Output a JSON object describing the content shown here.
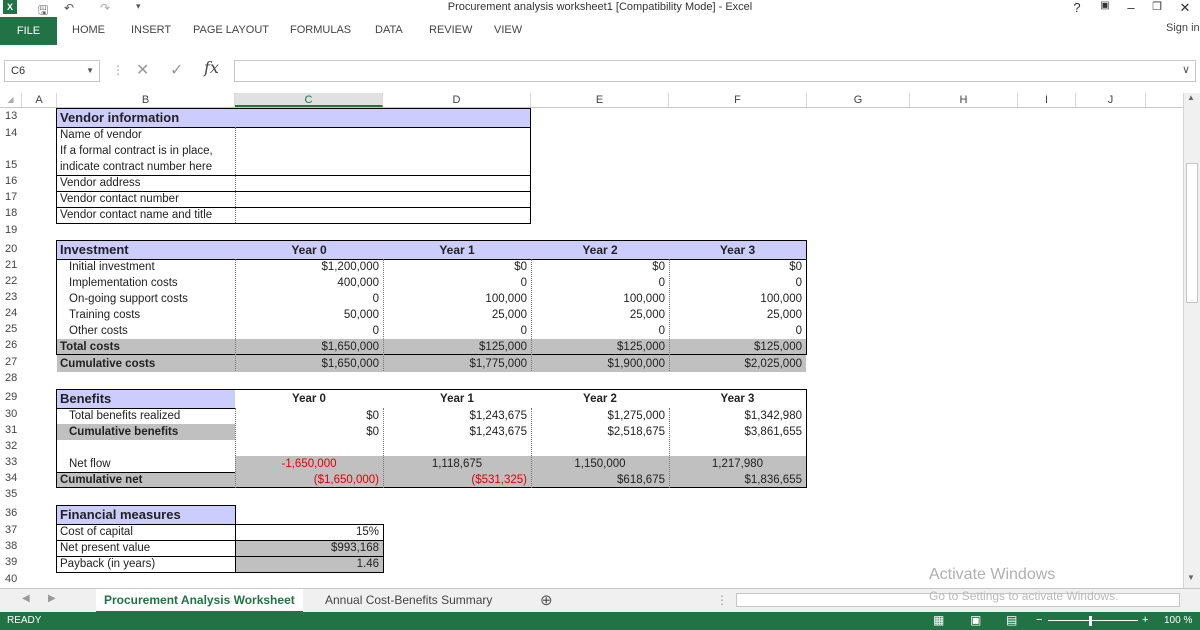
{
  "window": {
    "title": "Procurement analysis worksheet1  [Compatibility Mode] - Excel",
    "help": "?",
    "sign_in": "Sign in"
  },
  "ribbon": {
    "file": "FILE",
    "tabs": [
      "HOME",
      "INSERT",
      "PAGE LAYOUT",
      "FORMULAS",
      "DATA",
      "REVIEW",
      "VIEW"
    ]
  },
  "formula_bar": {
    "name_box": "C6",
    "fx": "fx"
  },
  "columns": [
    "A",
    "B",
    "C",
    "D",
    "E",
    "F",
    "G",
    "H",
    "I",
    "J"
  ],
  "rows": [
    "13",
    "14",
    "15",
    "16",
    "17",
    "18",
    "19",
    "20",
    "21",
    "22",
    "23",
    "24",
    "25",
    "26",
    "27",
    "28",
    "29",
    "30",
    "31",
    "32",
    "33",
    "34",
    "35",
    "36",
    "37",
    "38",
    "39",
    "40"
  ],
  "vendor": {
    "title": "Vendor information",
    "fields": [
      "Name of vendor",
      "If a formal contract is in place,",
      "indicate contract number here",
      "Vendor address",
      "Vendor contact number",
      "Vendor contact name and title"
    ]
  },
  "investment": {
    "title": "Investment",
    "years": [
      "Year 0",
      "Year 1",
      "Year 2",
      "Year 3"
    ],
    "rows": [
      {
        "label": "Initial investment",
        "values": [
          "$1,200,000",
          "$0",
          "$0",
          "$0"
        ]
      },
      {
        "label": "Implementation costs",
        "values": [
          "400,000",
          "0",
          "0",
          "0"
        ]
      },
      {
        "label": "On-going support costs",
        "values": [
          "0",
          "100,000",
          "100,000",
          "100,000"
        ]
      },
      {
        "label": "Training costs",
        "values": [
          "50,000",
          "25,000",
          "25,000",
          "25,000"
        ]
      },
      {
        "label": "Other costs",
        "values": [
          "0",
          "0",
          "0",
          "0"
        ]
      }
    ],
    "total": {
      "label": "Total costs",
      "values": [
        "$1,650,000",
        "$125,000",
        "$125,000",
        "$125,000"
      ]
    },
    "cumulative": {
      "label": "Cumulative costs",
      "values": [
        "$1,650,000",
        "$1,775,000",
        "$1,900,000",
        "$2,025,000"
      ]
    }
  },
  "benefits": {
    "title": "Benefits",
    "years": [
      "Year 0",
      "Year 1",
      "Year 2",
      "Year 3"
    ],
    "realized": {
      "label": "Total benefits realized",
      "values": [
        "$0",
        "$1,243,675",
        "$1,275,000",
        "$1,342,980"
      ]
    },
    "cumulative": {
      "label": "Cumulative benefits",
      "values": [
        "$0",
        "$1,243,675",
        "$2,518,675",
        "$3,861,655"
      ]
    },
    "net_flow": {
      "label": "Net flow",
      "values": [
        "-1,650,000",
        "1,118,675",
        "1,150,000",
        "1,217,980"
      ]
    },
    "cumulative_net": {
      "label": "Cumulative net",
      "values": [
        "($1,650,000)",
        "($531,325)",
        "$618,675",
        "$1,836,655"
      ]
    }
  },
  "financial": {
    "title": "Financial measures",
    "rows": [
      {
        "label": "Cost of capital",
        "value": "15%"
      },
      {
        "label": "Net present value",
        "value": "$993,168"
      },
      {
        "label": "Payback (in years)",
        "value": "1.46"
      }
    ]
  },
  "sheets": [
    "Procurement Analysis Worksheet",
    "Annual Cost-Benefits Summary"
  ],
  "status": {
    "ready": "READY",
    "zoom": "100 %"
  },
  "watermark": {
    "line1": "Activate Windows",
    "line2": "Go to Settings to activate Windows."
  },
  "colors": {
    "excel_green": "#217346",
    "header_fill": "#ccccff",
    "total_fill": "#c0c0c0",
    "negative": "#e00000"
  }
}
